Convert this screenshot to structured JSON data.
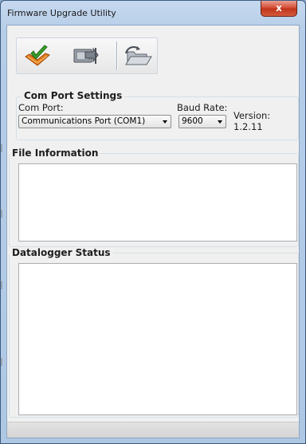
{
  "window": {
    "title": "Firmware Upgrade Utility",
    "close_label": "x"
  },
  "toolbar": {
    "buttons": [
      {
        "icon": "checkmark-tray-icon",
        "tooltip": ""
      },
      {
        "icon": "send-to-device-icon",
        "tooltip": ""
      },
      {
        "icon": "open-folder-icon",
        "tooltip": ""
      }
    ]
  },
  "com_port_settings": {
    "title": "Com Port Settings",
    "com_port_label": "Com Port:",
    "com_port_value": "Communications Port (COM1)",
    "baud_rate_label": "Baud Rate:",
    "baud_rate_value": "9600",
    "version": "Version: 1.2.11"
  },
  "file_information": {
    "title": "File Information",
    "content": ""
  },
  "datalogger_status": {
    "title": "Datalogger Status",
    "content": ""
  },
  "colors": {
    "title_bar": "#b6cde8",
    "close_button": "#c8402a",
    "panel_bg": "#f0f0f0",
    "check_green": "#3aa02a",
    "tray_orange": "#e07a1a"
  }
}
